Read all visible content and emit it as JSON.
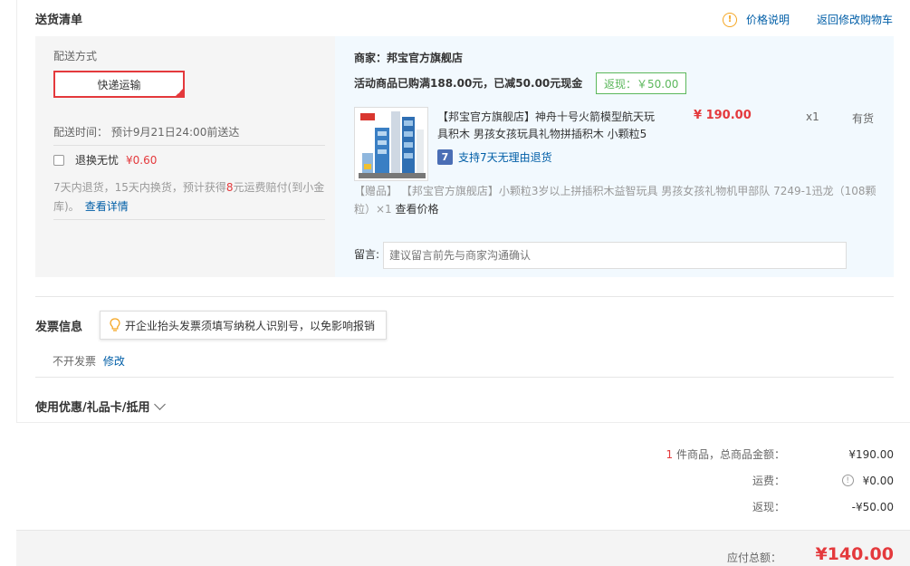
{
  "section": {
    "title": "送货清单"
  },
  "header_links": {
    "price_note": "价格说明",
    "back_cart": "返回修改购物车"
  },
  "shipping": {
    "label": "配送方式",
    "method": "快递运输",
    "time_label": "配送时间：",
    "time_value": "预计9月21日24:00前送达",
    "insurance_label": "退换无忧",
    "insurance_fee": "¥0.60",
    "insurance_desc_a": "7天内退货，15天内换货，预计获得",
    "insurance_desc_num": "8",
    "insurance_desc_b": "元运费赔付(到小金库)。",
    "insurance_link": "查看详情"
  },
  "order": {
    "shop": "商家：邦宝官方旗舰店",
    "promo": "活动商品已购满188.00元，已减50.00元现金",
    "cashback_tag": "返现：￥50.00",
    "product_name": "【邦宝官方旗舰店】神舟十号火箭模型航天玩具积木 男孩女孩玩具礼物拼插积木 小颗粒5",
    "price": "¥ 190.00",
    "qty": "x1",
    "stock": "有货",
    "return_policy": "支持7天无理由退货",
    "return_icon": "7",
    "gift": "【赠品】 【邦宝官方旗舰店】小颗粒3岁以上拼插积木益智玩具 男孩女孩礼物机甲部队 7249-1迅龙（108颗粒）×1",
    "gift_link": "查看价格",
    "msg_label": "留言:",
    "msg_placeholder": "建议留言前先与商家沟通确认"
  },
  "invoice": {
    "title": "发票信息",
    "tip": "开企业抬头发票须填写纳税人识别号，以免影响报销",
    "value": "不开发票",
    "edit": "修改"
  },
  "coupon": {
    "label": "使用优惠/礼品卡/抵用"
  },
  "summary": {
    "count": "1",
    "goods_label": "件商品，总商品金额：",
    "goods_value": "¥190.00",
    "freight_label": "运费：",
    "freight_value": "¥0.00",
    "cashback_label": "返现：",
    "cashback_value": "-¥50.00",
    "total_label": "应付总额：",
    "total_value": "¥140.00"
  },
  "colors": {
    "accent_red": "#e4393c",
    "link_blue": "#005ea7",
    "green": "#5bb75b"
  }
}
